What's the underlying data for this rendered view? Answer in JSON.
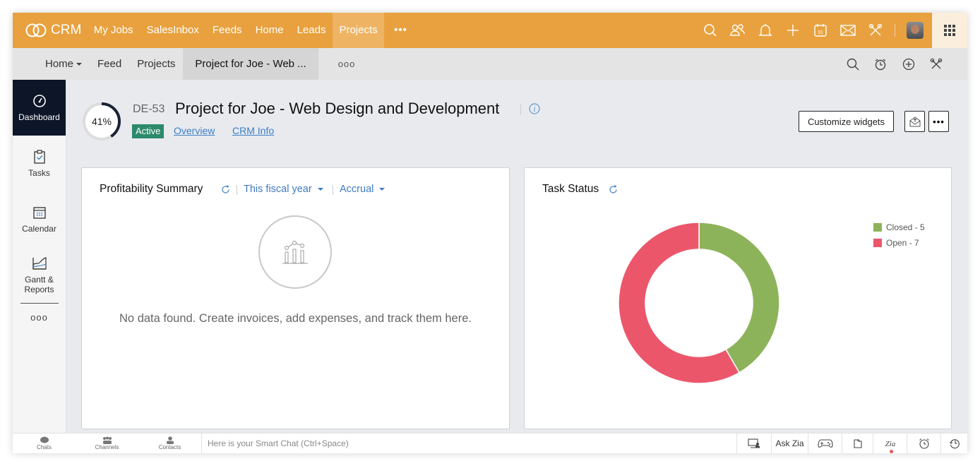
{
  "topbar": {
    "logo_text": "CRM",
    "nav": [
      "My Jobs",
      "SalesInbox",
      "Feeds",
      "Home",
      "Leads",
      "Projects"
    ],
    "active_nav": "Projects",
    "more": "•••",
    "icons": [
      "search-icon",
      "contacts-icon",
      "bell-icon",
      "plus-icon",
      "calendar-icon",
      "mail-icon",
      "tools-icon"
    ],
    "calendar_day": "31"
  },
  "subbar": {
    "items": [
      "Home",
      "Feed",
      "Projects",
      "Project for Joe - Web ..."
    ],
    "active": "Project for Joe - Web ...",
    "more": "ooo",
    "icons": [
      "search-icon",
      "alarm-icon",
      "add-circle-icon",
      "tools-icon"
    ]
  },
  "sidebar": {
    "items": [
      {
        "label": "Dashboard",
        "icon": "gauge-icon",
        "active": true
      },
      {
        "label": "Tasks",
        "icon": "clipboard-check-icon",
        "active": false
      },
      {
        "label": "Calendar",
        "icon": "calendar-icon",
        "active": false
      },
      {
        "label": "Gantt & Reports",
        "icon": "area-chart-icon",
        "active": false
      }
    ],
    "more": "ooo"
  },
  "project": {
    "progress_percent": 41,
    "progress_label": "41%",
    "id": "DE-53",
    "title": "Project for Joe - Web Design and Development",
    "status": "Active",
    "status_color": "#2c8a6b",
    "links": [
      "Overview",
      "CRM Info"
    ]
  },
  "actions": {
    "customize_label": "Customize widgets",
    "more": "•••"
  },
  "profitability": {
    "title": "Profitability Summary",
    "period": "This fiscal year",
    "basis": "Accrual",
    "empty_text": "No data found. Create invoices, add expenses, and track them here."
  },
  "task_status": {
    "title": "Task Status"
  },
  "chart_data": {
    "type": "pie",
    "title": "Task Status",
    "donut": true,
    "categories": [
      "Closed",
      "Open"
    ],
    "values": [
      5,
      7
    ],
    "colors": [
      "#8db35a",
      "#ec566b"
    ],
    "legend": [
      "Closed - 5",
      "Open - 7"
    ],
    "legend_position": "top-right"
  },
  "bottombar": {
    "tabs": [
      "Chats",
      "Channels",
      "Contacts"
    ],
    "placeholder": "Here is your Smart Chat (Ctrl+Space)",
    "ask_zia": "Ask Zia"
  }
}
